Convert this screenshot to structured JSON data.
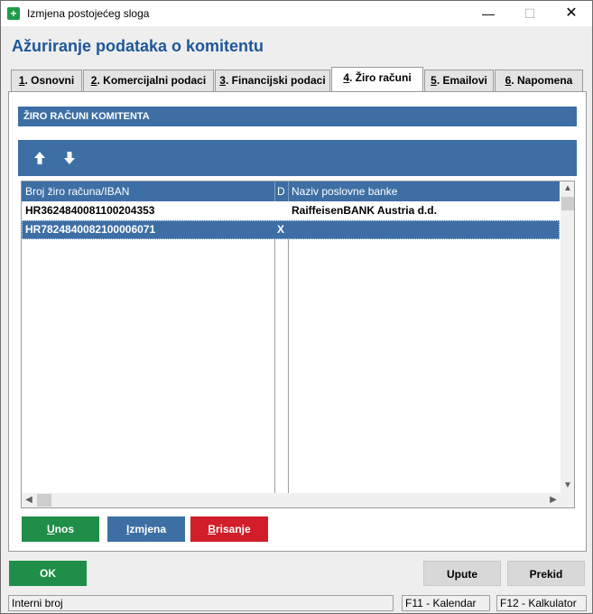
{
  "window": {
    "title": "Izmjena postojećeg sloga",
    "minimize": "—",
    "maximize": "☐",
    "close": "✕"
  },
  "page": {
    "title": "Ažuriranje podataka o komitentu"
  },
  "tabs": [
    {
      "num": "1",
      "label": ". Osnovni"
    },
    {
      "num": "2",
      "label": ". Komercijalni podaci"
    },
    {
      "num": "3",
      "label": ". Financijski podaci"
    },
    {
      "num": "4",
      "label": ". Žiro računi"
    },
    {
      "num": "5",
      "label": ". Emailovi"
    },
    {
      "num": "6",
      "label": ". Napomena"
    }
  ],
  "section": {
    "title": "ŽIRO RAČUNI KOMITENTA"
  },
  "toolbar": {
    "up_icon": "arrow-up",
    "down_icon": "arrow-down"
  },
  "grid": {
    "columns": [
      "Broj žiro računa/IBAN",
      "D",
      "Naziv poslovne banke"
    ],
    "rows": [
      {
        "iban": "HR3624840081100204353",
        "d": "",
        "bank": "RaiffeisenBANK Austria d.d."
      },
      {
        "iban": "HR7824840082100006071",
        "d": "X",
        "bank": ""
      }
    ],
    "selected_row": 1
  },
  "actions": {
    "unos_u": "U",
    "unos_rest": "nos",
    "izmjena_u": "I",
    "izmjena_rest": "zmjena",
    "brisanje_u": "B",
    "brisanje_rest": "risanje",
    "ok": "OK",
    "upute": "Upute",
    "prekid": "Prekid"
  },
  "statusbar": {
    "field": "Interni broj",
    "f11": "F11 - Kalendar",
    "f12": "F12 - Kalkulator"
  },
  "colors": {
    "accent": "#3d6fa5",
    "title": "#1e5799",
    "green": "#1e8e48",
    "red": "#d11e2a"
  }
}
